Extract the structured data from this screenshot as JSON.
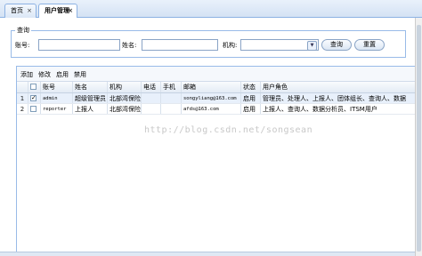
{
  "tabs": [
    {
      "label": "首页",
      "close": "×"
    },
    {
      "label": "用户管理",
      "close": "×"
    }
  ],
  "query": {
    "legend": "查询",
    "account_label": "账号:",
    "account_value": "",
    "name_label": "姓名:",
    "name_value": "",
    "org_label": "机构:",
    "org_selected": "",
    "query_button": "查询",
    "reset_button": "重置"
  },
  "toolbar": {
    "add": "添加",
    "edit": "修改",
    "enable": "启用",
    "disable": "禁用"
  },
  "table": {
    "columns": [
      "账号",
      "姓名",
      "机构",
      "电话",
      "手机",
      "邮箱",
      "状态",
      "用户角色"
    ],
    "rows": [
      {
        "num": "1",
        "checked": true,
        "account": "admin",
        "name": "超级管理员",
        "org": "北部湾保险",
        "phone": "",
        "mobile": "",
        "email": "songyliang@163.com",
        "status": "启用",
        "roles": "管理员、处理人、上报人、团体组长、查询人、数据"
      },
      {
        "num": "2",
        "checked": false,
        "account": "reporter",
        "name": "上报人",
        "org": "北部湾保险",
        "phone": "",
        "mobile": "",
        "email": "afds@163.com",
        "status": "启用",
        "roles": "上报人、查询人、数据分析员、ITSM用户"
      }
    ]
  },
  "watermark": "http://blog.csdn.net/songsean"
}
